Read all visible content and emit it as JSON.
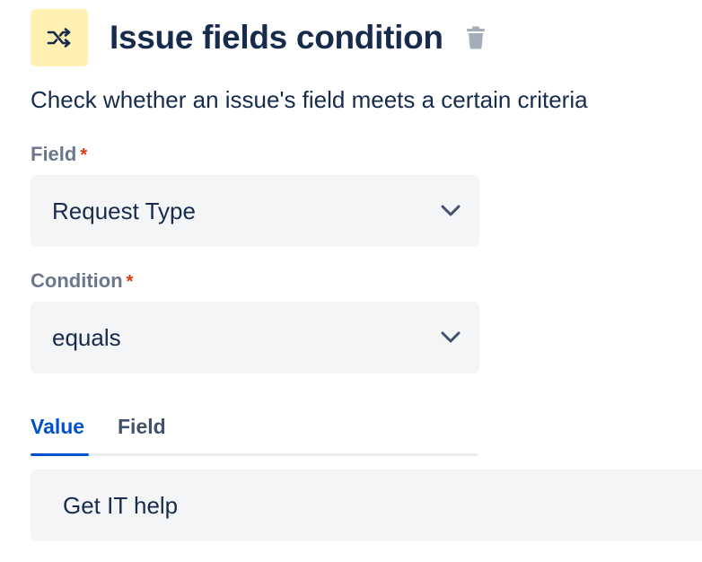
{
  "header": {
    "title": "Issue fields condition",
    "icon": "shuffle-icon",
    "icon_bg": "#fff0b3",
    "delete_icon": "trash-icon"
  },
  "description": "Check whether an issue's field meets a certain criteria",
  "field": {
    "label": "Field",
    "required_marker": "*",
    "value": "Request Type"
  },
  "condition": {
    "label": "Condition",
    "required_marker": "*",
    "value": "equals"
  },
  "tabs": {
    "items": [
      {
        "label": "Value",
        "active": true
      },
      {
        "label": "Field",
        "active": false
      }
    ],
    "active_color": "#0052cc"
  },
  "value_input": {
    "value": "Get IT help"
  },
  "colors": {
    "text": "#172b4d",
    "label": "#6b778c",
    "required": "#de350b",
    "field_bg": "#f4f5f7"
  }
}
